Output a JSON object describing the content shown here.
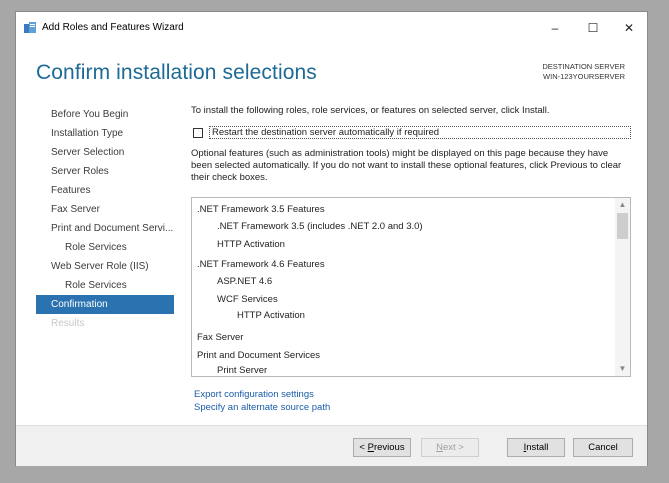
{
  "window": {
    "title": "Add Roles and Features Wizard",
    "controls": {
      "minimize": "–",
      "maximize": "☐",
      "close": "✕"
    }
  },
  "header": {
    "page_title": "Confirm installation selections",
    "destination_label": "DESTINATION SERVER",
    "destination_server": "WIN-123YOURSERVER"
  },
  "nav": {
    "items": [
      {
        "label": "Before You Begin",
        "state": "normal"
      },
      {
        "label": "Installation Type",
        "state": "normal"
      },
      {
        "label": "Server Selection",
        "state": "normal"
      },
      {
        "label": "Server Roles",
        "state": "normal"
      },
      {
        "label": "Features",
        "state": "normal"
      },
      {
        "label": "Fax Server",
        "state": "normal"
      },
      {
        "label": "Print and Document Servi...",
        "state": "normal"
      },
      {
        "label": "Role Services",
        "state": "sub"
      },
      {
        "label": "Web Server Role (IIS)",
        "state": "normal"
      },
      {
        "label": "Role Services",
        "state": "sub"
      },
      {
        "label": "Confirmation",
        "state": "active"
      },
      {
        "label": "Results",
        "state": "disabled"
      }
    ]
  },
  "content": {
    "intro": "To install the following roles, role services, or features on selected server, click Install.",
    "restart_label": "Restart the destination server automatically if required",
    "restart_checked": false,
    "optional_text": "Optional features (such as administration tools) might be displayed on this page because they have been selected automatically. If you do not want to install these optional features, click Previous to clear their check boxes."
  },
  "selections": [
    {
      "label": ".NET Framework 3.5 Features",
      "level": 0
    },
    {
      "label": ".NET Framework 3.5 (includes .NET 2.0 and 3.0)",
      "level": 1
    },
    {
      "label": "HTTP Activation",
      "level": 1
    },
    {
      "label": ".NET Framework 4.6 Features",
      "level": 0
    },
    {
      "label": "ASP.NET 4.6",
      "level": 1
    },
    {
      "label": "WCF Services",
      "level": 1
    },
    {
      "label": "HTTP Activation",
      "level": 2
    },
    {
      "label": "Fax Server",
      "level": 0
    },
    {
      "label": "Print and Document Services",
      "level": 0
    },
    {
      "label": "Print Server",
      "level": 1
    }
  ],
  "links": {
    "export": "Export configuration settings",
    "alternate_source": "Specify an alternate source path"
  },
  "buttons": {
    "previous_prefix": "< ",
    "previous_key": "P",
    "previous_rest": "revious",
    "next_key": "N",
    "next_rest": "ext >",
    "install_key": "I",
    "install_rest": "nstall",
    "cancel": "Cancel"
  }
}
